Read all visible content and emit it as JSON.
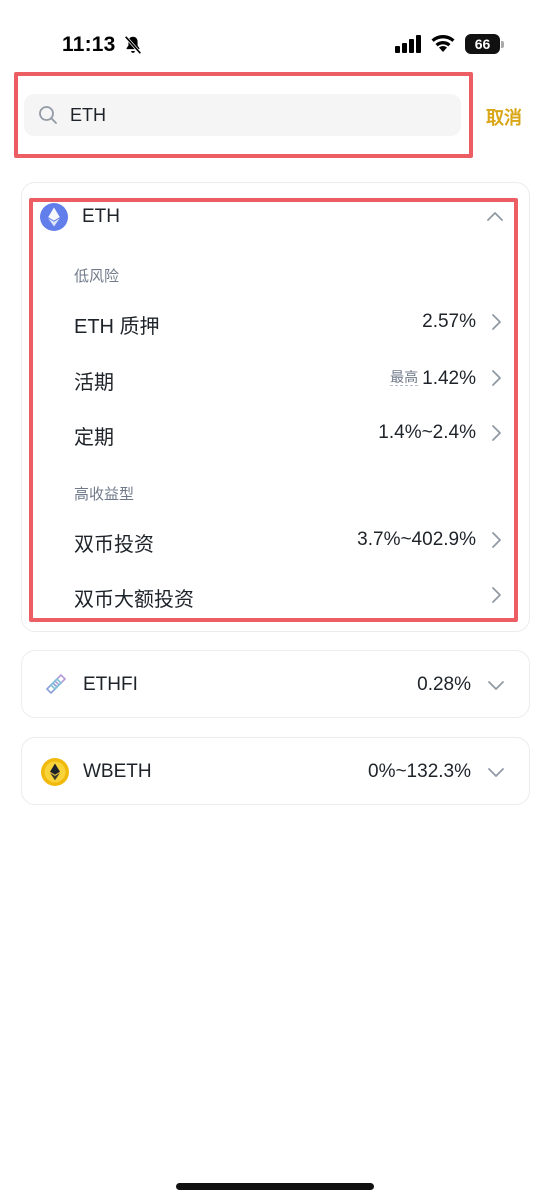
{
  "status_bar": {
    "time": "11:13",
    "battery": "66"
  },
  "search": {
    "value": "ETH",
    "cancel_label": "取消"
  },
  "colors": {
    "accent": "#d9a618",
    "highlight": "#ec5d64",
    "eth_icon": "#627eea",
    "wbeth_icon": "#f0b90b"
  },
  "eth_card": {
    "icon": "ethereum-icon",
    "name": "ETH",
    "sections": [
      {
        "label": "低风险",
        "items": [
          {
            "name": "ETH 质押",
            "prefix": "",
            "rate": "2.57%"
          },
          {
            "name": "活期",
            "prefix": "最高",
            "rate": "1.42%"
          },
          {
            "name": "定期",
            "prefix": "",
            "rate": "1.4%~2.4%"
          }
        ]
      },
      {
        "label": "高收益型",
        "items": [
          {
            "name": "双币投资",
            "prefix": "",
            "rate": "3.7%~402.9%"
          },
          {
            "name": "双币大额投资",
            "prefix": "",
            "rate": ""
          }
        ]
      }
    ]
  },
  "other_coins": [
    {
      "icon": "ethfi-icon",
      "name": "ETHFI",
      "rate": "0.28%"
    },
    {
      "icon": "wbeth-icon",
      "name": "WBETH",
      "rate": "0%~132.3%"
    }
  ]
}
